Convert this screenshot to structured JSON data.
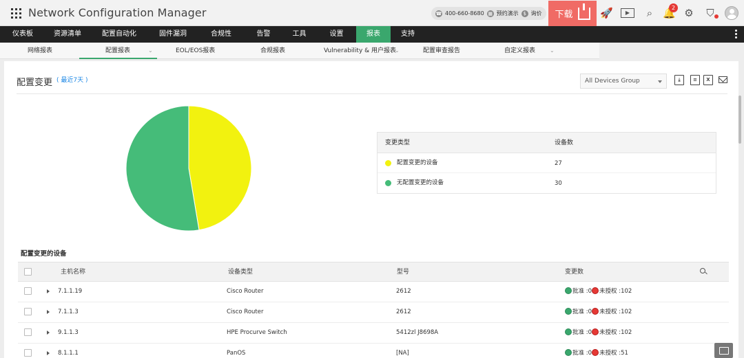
{
  "header": {
    "app_title": "Network Configuration Manager",
    "phone": "400-660-8680",
    "demo": "预约演示",
    "price": "询价",
    "download": "下载",
    "notifications_count": "2"
  },
  "mainnav": {
    "items": [
      {
        "label": "仪表板",
        "active": false
      },
      {
        "label": "资源清单",
        "active": false
      },
      {
        "label": "配置自动化",
        "active": false
      },
      {
        "label": "固件漏洞",
        "active": false
      },
      {
        "label": "合规性",
        "active": false
      },
      {
        "label": "告警",
        "active": false
      },
      {
        "label": "工具",
        "active": false
      },
      {
        "label": "设置",
        "active": false
      },
      {
        "label": "报表",
        "active": true
      },
      {
        "label": "支持",
        "active": false
      }
    ]
  },
  "subnav": {
    "items": [
      {
        "label": "网络报表"
      },
      {
        "label": "配置报表",
        "active": true
      },
      {
        "label": "EOL/EOS报表"
      },
      {
        "label": "合规报表"
      },
      {
        "label": "Vulnerability & 用户报表"
      },
      {
        "label": "配置审查报告"
      },
      {
        "label": "自定义报表"
      }
    ]
  },
  "page": {
    "title": "配置变更",
    "range": "( 最近7天 )",
    "group_select": "All Devices Group"
  },
  "legend": {
    "col_type": "变更类型",
    "col_count": "设备数",
    "rows": [
      {
        "name": "配置变更的设备",
        "count": "27",
        "color": "#f2f20f"
      },
      {
        "name": "无配置变更的设备",
        "count": "30",
        "color": "#45bc79"
      }
    ]
  },
  "chart_data": {
    "type": "pie",
    "slices": [
      {
        "name": "配置变更的设备",
        "value": 27,
        "color": "#f2f20f"
      },
      {
        "name": "无配置变更的设备",
        "value": 30,
        "color": "#45bc79"
      }
    ]
  },
  "devices": {
    "title": "配置变更的设备",
    "columns": {
      "host": "主机名称",
      "type": "设备类型",
      "model": "型号",
      "changes": "变更数"
    },
    "approved_label": "批准 : ",
    "unauth_label": "未授权 : ",
    "rows": [
      {
        "host": "7.1.1.19",
        "type": "Cisco Router",
        "model": "2612",
        "approved": "0",
        "unauth": "102"
      },
      {
        "host": "7.1.1.3",
        "type": "Cisco Router",
        "model": "2612",
        "approved": "0",
        "unauth": "102"
      },
      {
        "host": "9.1.1.3",
        "type": "HPE Procurve Switch",
        "model": "5412zl J8698A",
        "approved": "0",
        "unauth": "102"
      },
      {
        "host": "8.1.1.1",
        "type": "PanOS",
        "model": "[NA]",
        "approved": "0",
        "unauth": "51"
      }
    ]
  }
}
